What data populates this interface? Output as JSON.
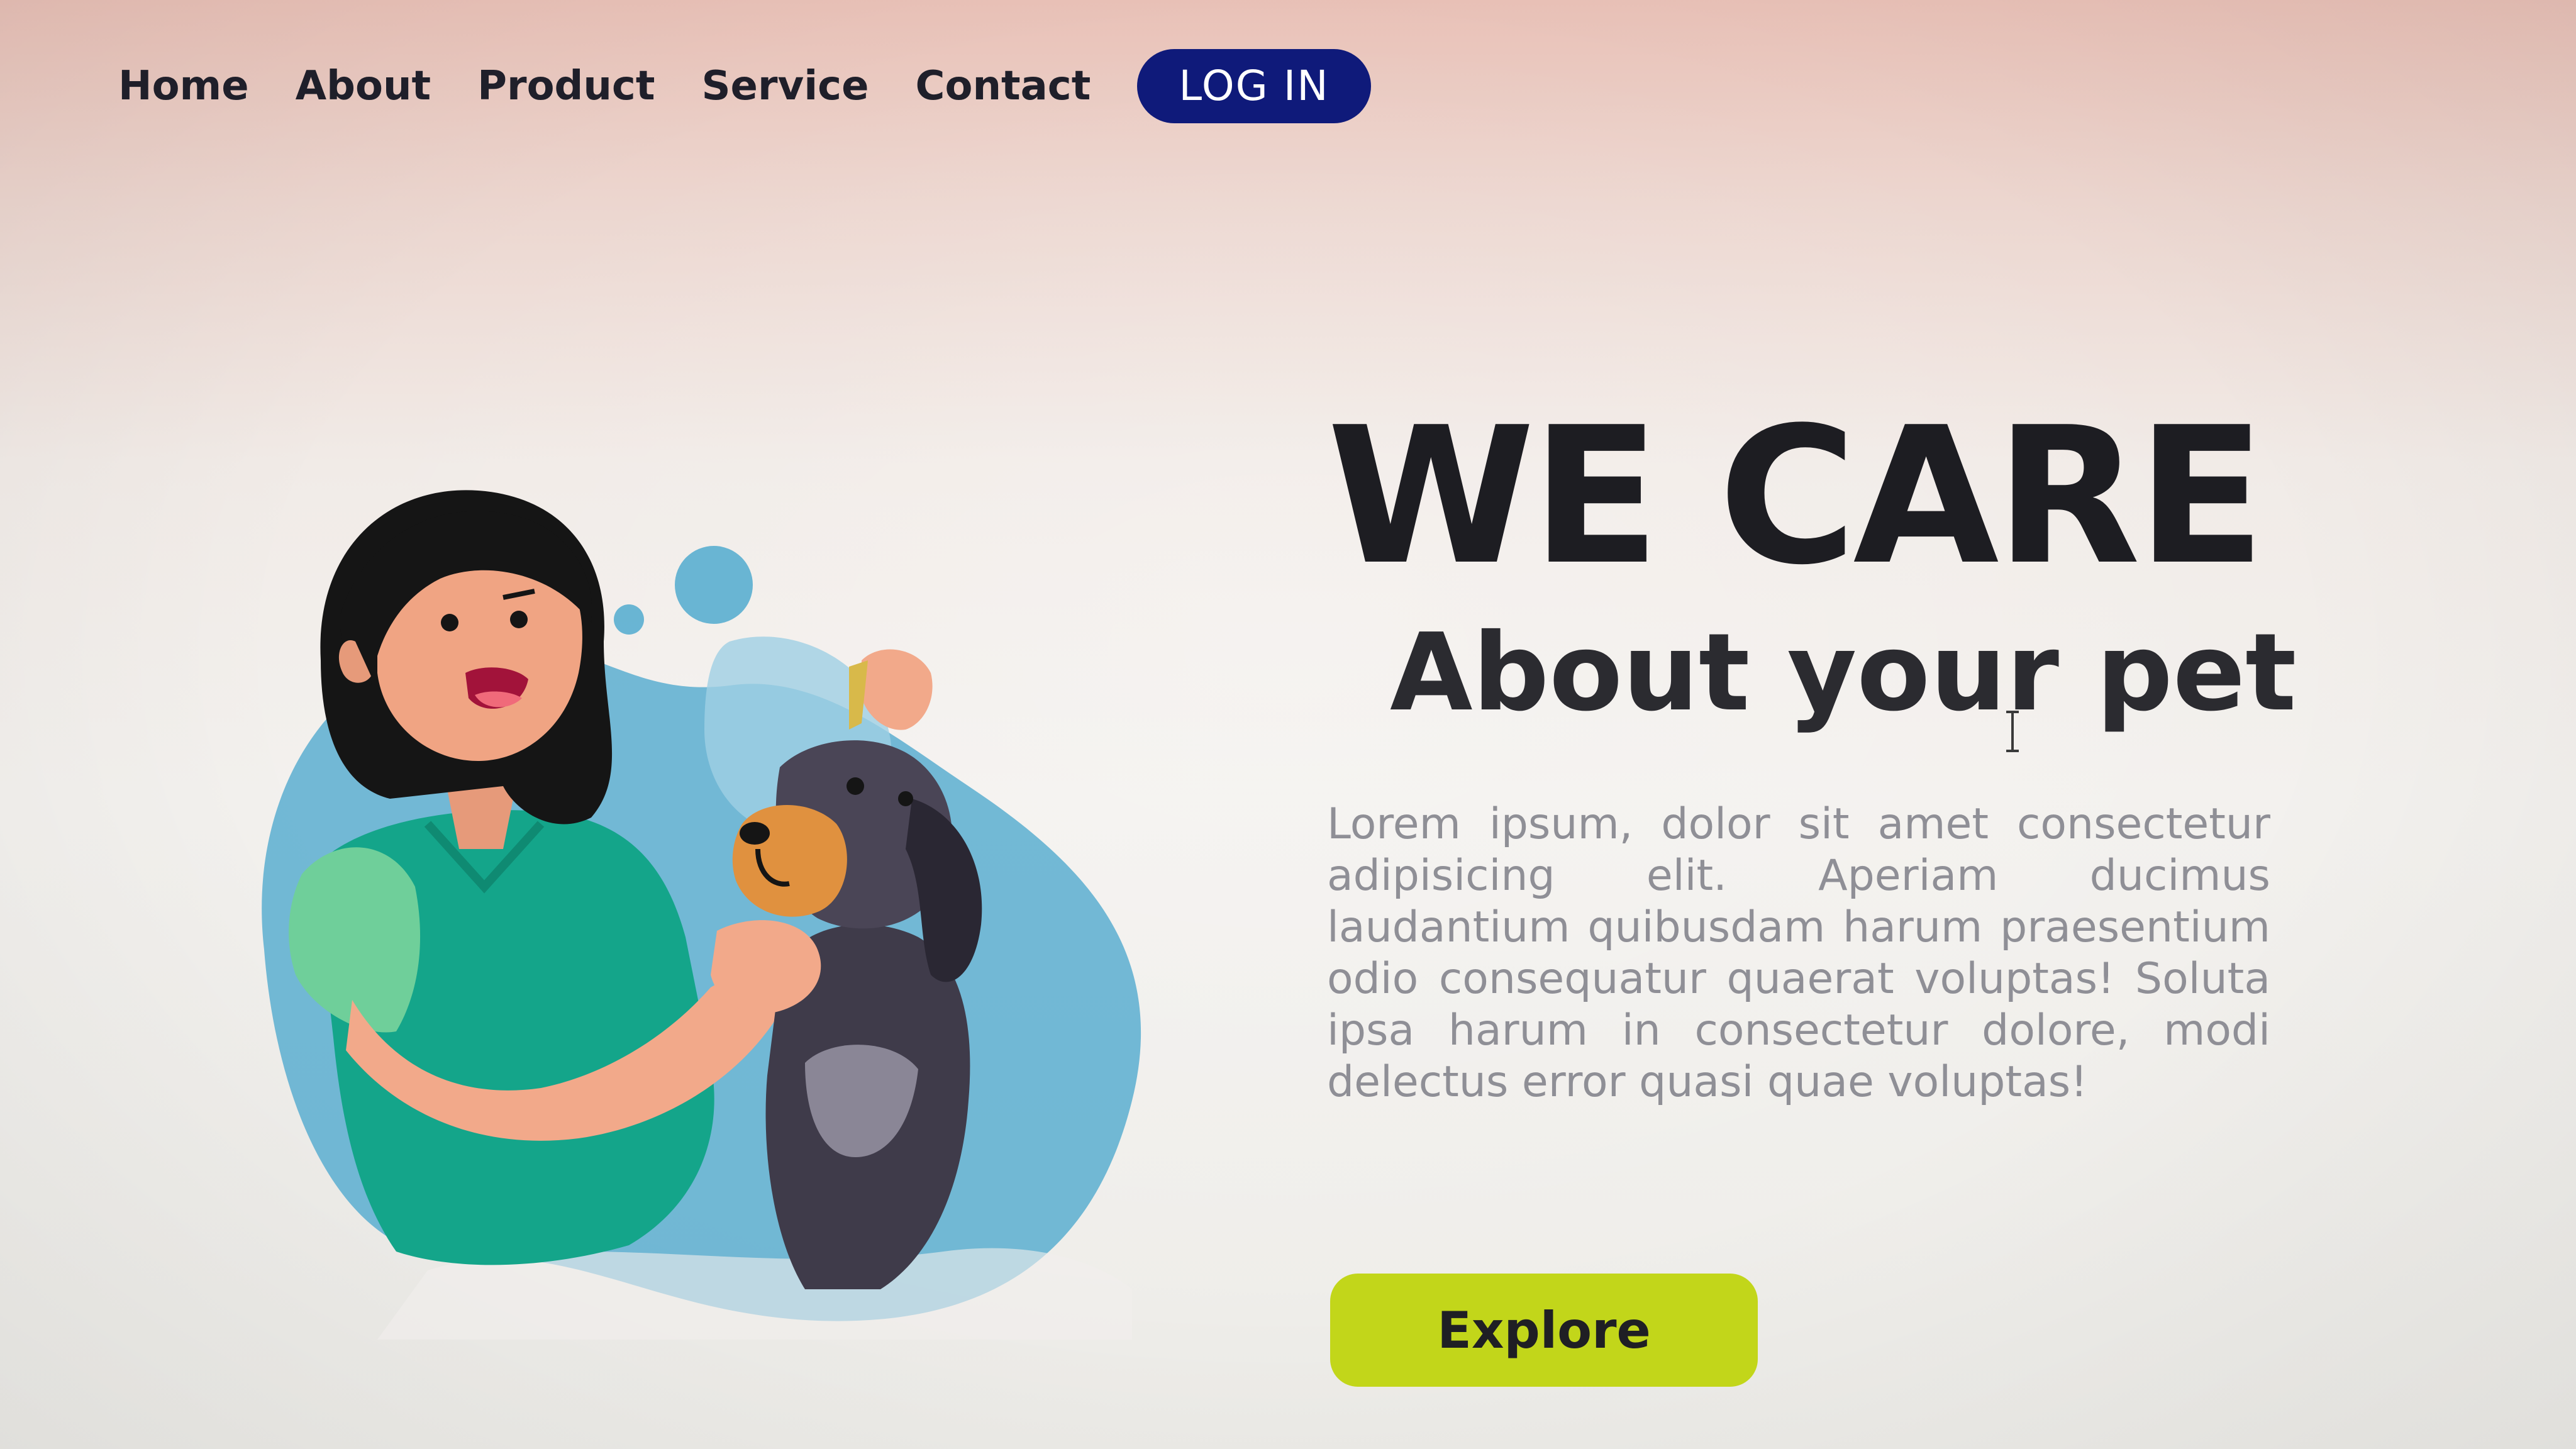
{
  "nav": {
    "items": [
      {
        "label": "Home"
      },
      {
        "label": "About"
      },
      {
        "label": "Product"
      },
      {
        "label": "Service"
      },
      {
        "label": "Contact"
      }
    ],
    "login_label": "LOG IN"
  },
  "hero": {
    "headline": "WE CARE",
    "subheadline": "About your pet",
    "body": "Lorem ipsum, dolor sit amet consectetur adipisicing elit. Aperiam ducimus laudantium quibusdam harum praesentium odio consequatur quaerat voluptas! Soluta ipsa harum in consectetur dolore, modi delectus error quasi quae voluptas!",
    "cta_label": "Explore"
  },
  "colors": {
    "login_button": "#0f1a7a",
    "cta_button": "#c2d61a",
    "headline": "#1d1d22",
    "body_text": "#8f8f96",
    "blob_blue": "#5aaed0",
    "scrub_green": "#18a58a"
  },
  "icons": {
    "cursor": "text-cursor-icon"
  }
}
